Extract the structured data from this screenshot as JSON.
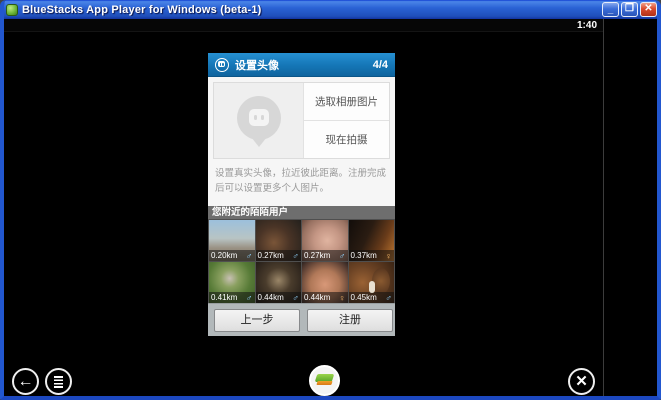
{
  "window": {
    "title": "BlueStacks App Player for Windows (beta-1)",
    "minimize_glyph": "_",
    "maximize_glyph": "❐",
    "close_glyph": "✕"
  },
  "status_bar": {
    "time": "1:40"
  },
  "app": {
    "header": {
      "title": "设置头像",
      "step": "4/4"
    },
    "avatar_card": {
      "buttons": [
        {
          "label": "选取相册图片"
        },
        {
          "label": "现在拍摄"
        }
      ]
    },
    "description": "设置真实头像，拉近彼此距离。注册完成后可以设置更多个人图片。",
    "nearby": {
      "title": "您附近的陌陌用户",
      "photos": [
        {
          "distance": "0.20km",
          "gender": "♂"
        },
        {
          "distance": "0.27km",
          "gender": "♂"
        },
        {
          "distance": "0.27km",
          "gender": "♂"
        },
        {
          "distance": "0.37km",
          "gender": "♀"
        },
        {
          "distance": "0.41km",
          "gender": "♂"
        },
        {
          "distance": "0.44km",
          "gender": "♂"
        },
        {
          "distance": "0.44km",
          "gender": "♀"
        },
        {
          "distance": "0.45km",
          "gender": "♂"
        }
      ]
    },
    "footer_buttons": [
      {
        "label": "上一步"
      },
      {
        "label": "注册"
      }
    ]
  },
  "nav": {
    "back_glyph": "←",
    "tools_glyph": "✕"
  },
  "icons": {
    "titlebar_app": "bluestacks-logo-icon",
    "app_header_logo": "momo-pin-icon",
    "avatar_placeholder": "momo-pin-placeholder-icon",
    "nav_back": "back-arrow-icon",
    "nav_menu": "menu-lines-icon",
    "nav_center": "bluestacks-logo-icon",
    "nav_tools": "tools-icon"
  },
  "colors": {
    "app_header_blue": "#1576b6",
    "xp_titlebar_blue": "#2a62d4",
    "window_border_blue": "#2257cf",
    "nearby_bar_gray": "#6e6e6e",
    "footer_bar_gray": "#b2b8ba",
    "male_icon": "#8ecdf5",
    "female_icon": "#f5b86a"
  }
}
